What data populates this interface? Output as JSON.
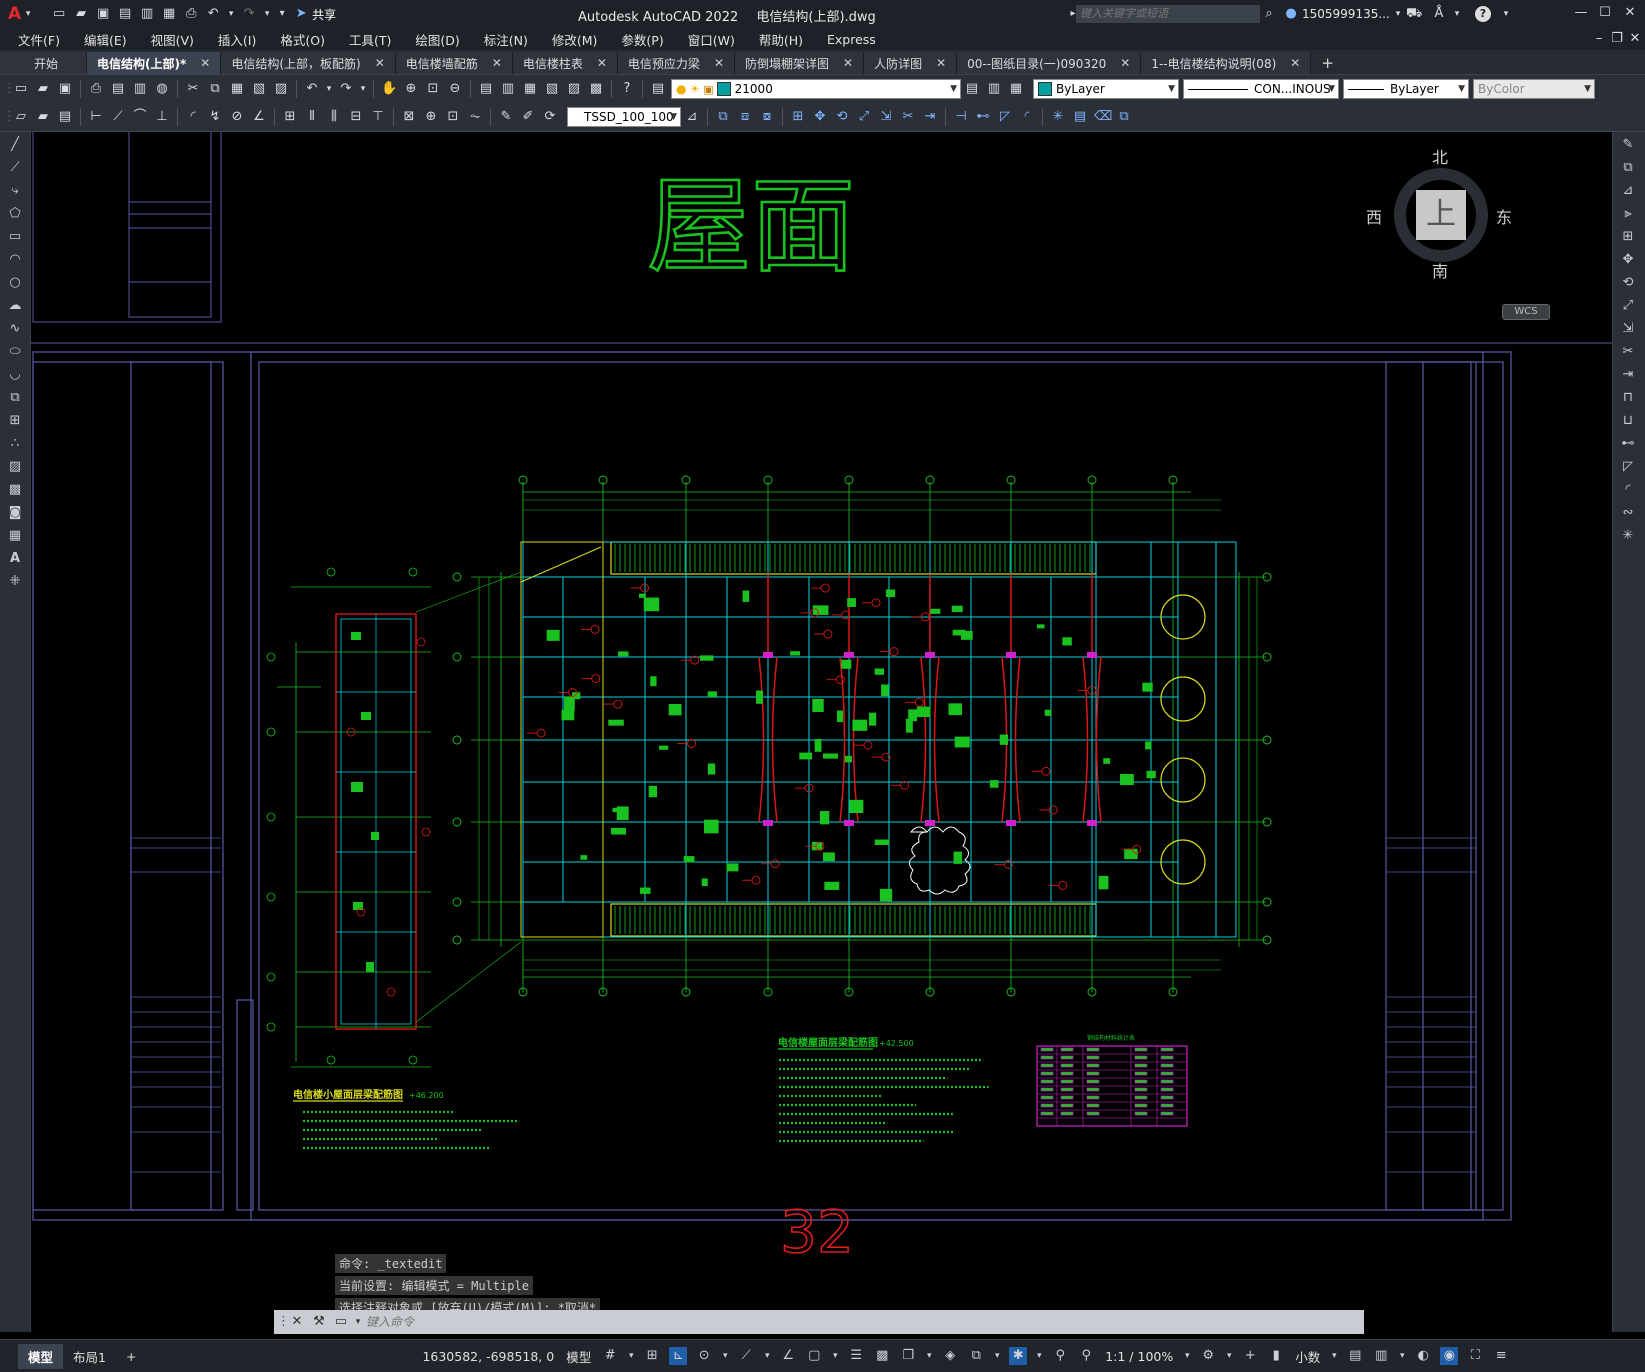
{
  "app": {
    "logo": "A",
    "title": "Autodesk AutoCAD 2022",
    "filename": "电信结构(上部).dwg",
    "share": "共享",
    "search_placeholder": "键入关键字或短语",
    "user": "1505999135...",
    "help": "?"
  },
  "menu": [
    "文件(F)",
    "编辑(E)",
    "视图(V)",
    "插入(I)",
    "格式(O)",
    "工具(T)",
    "绘图(D)",
    "标注(N)",
    "修改(M)",
    "参数(P)",
    "窗口(W)",
    "帮助(H)",
    "Express"
  ],
  "tabs": [
    {
      "label": "开始",
      "active": false,
      "close": false
    },
    {
      "label": "电信结构(上部)*",
      "active": true,
      "close": true
    },
    {
      "label": "电信结构(上部，板配筋)",
      "active": false,
      "close": true
    },
    {
      "label": "电信楼墙配筋",
      "active": false,
      "close": true
    },
    {
      "label": "电信楼柱表",
      "active": false,
      "close": true
    },
    {
      "label": "电信预应力梁",
      "active": false,
      "close": true
    },
    {
      "label": "防倒塌棚架详图",
      "active": false,
      "close": true
    },
    {
      "label": "人防详图",
      "active": false,
      "close": true
    },
    {
      "label": "00--图纸目录(一)090320",
      "active": false,
      "close": true
    },
    {
      "label": "1--电信楼结构说明(08)",
      "active": false,
      "close": true
    }
  ],
  "tab_add": "+",
  "toolbar": {
    "layer_value": "21000",
    "color_value": "ByLayer",
    "linetype_value": "CON...INOUS",
    "lineweight_value": "ByLayer",
    "plotstyle_value": "ByColor",
    "textstyle_value": "TSSD_100_100"
  },
  "colors": {
    "accent": "#3b4250",
    "drawing_green": "#19c21e",
    "drawing_cyan": "#00d0e0",
    "frame_blue": "#5a5aa8",
    "red_mark": "#d01818",
    "magenta": "#d020d0",
    "yellow": "#d8d820"
  },
  "viewcube": {
    "north": "北",
    "south": "南",
    "east": "东",
    "west": "西",
    "face": "上",
    "wcs": "WCS"
  },
  "drawing": {
    "big_title": "屋面",
    "plan_title_main": "电信楼屋面层梁配筋图",
    "plan_elev_main": "+42.500",
    "plan_title_small": "电信楼小屋面层梁配筋图",
    "plan_elev_small": "+46.200",
    "table_title": "钢结构材料统计表",
    "overlay_number": "32"
  },
  "command_history": [
    "命令: _textedit",
    "当前设置: 编辑模式 = Multiple",
    "选择注释对象或 [放弃(U)/模式(M)]: *取消*"
  ],
  "command_placeholder": "键入命令",
  "status": {
    "tabs": [
      "模型",
      "布局1"
    ],
    "add": "+",
    "coords": "1630582, -698518, 0",
    "model": "模型",
    "scale": "1:1 / 100%",
    "units": "小数"
  }
}
